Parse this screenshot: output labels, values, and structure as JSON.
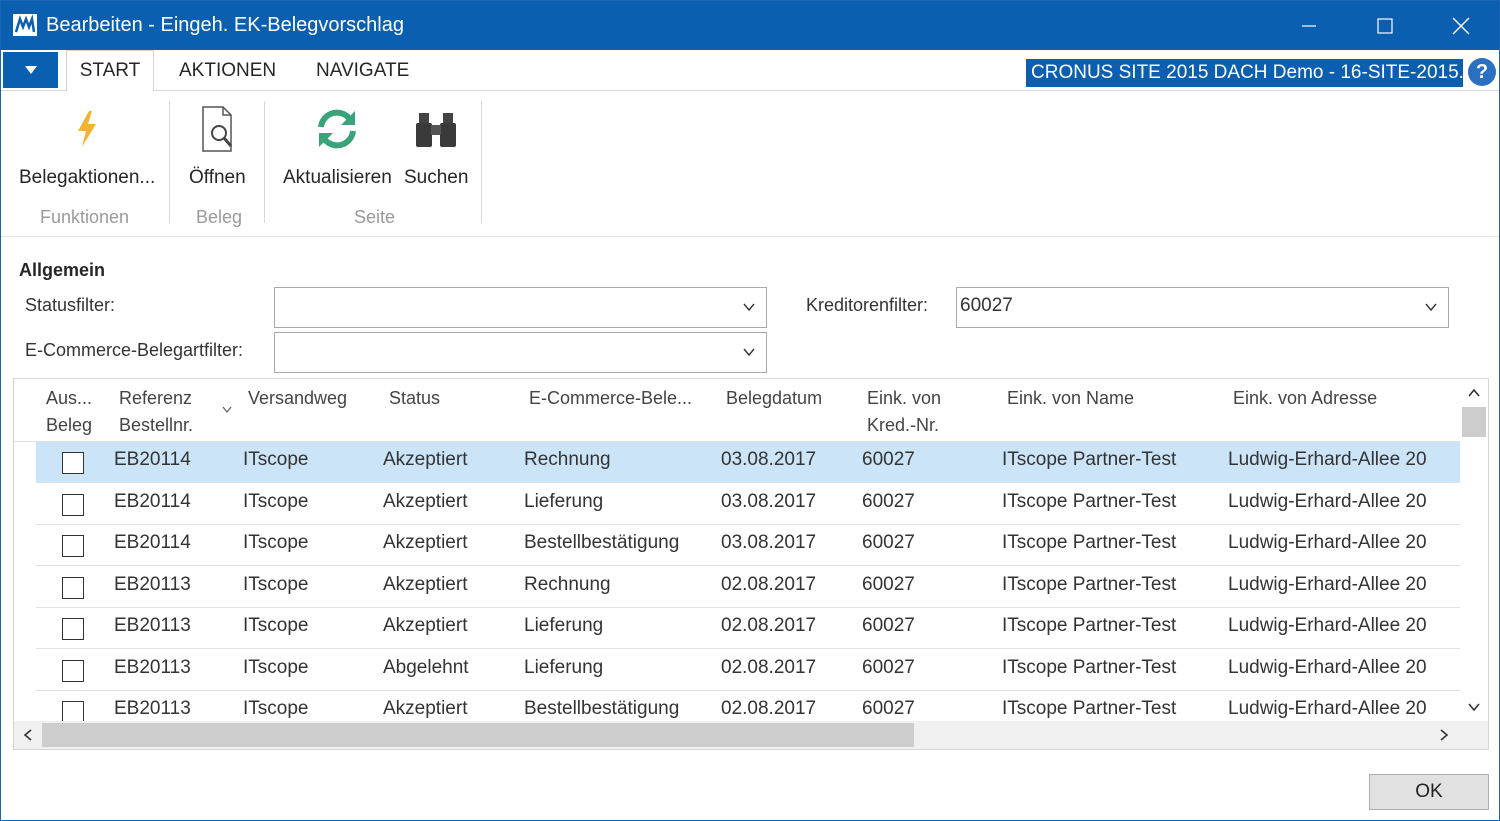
{
  "window": {
    "title": "Bearbeiten - Eingeh. EK-Belegvorschlag",
    "accent_color": "#0b5fb0"
  },
  "ribbon": {
    "tabs": [
      {
        "label": "START"
      },
      {
        "label": "AKTIONEN"
      },
      {
        "label": "NAVIGATE"
      }
    ],
    "company": "CRONUS SITE 2015 DACH Demo - 16-SITE-2015...",
    "help": "?",
    "buttons": [
      {
        "label": "Belegaktionen...",
        "icon": "lightning-icon"
      },
      {
        "label": "Öffnen",
        "icon": "open-document-icon"
      },
      {
        "label": "Aktualisieren",
        "icon": "refresh-icon"
      },
      {
        "label": "Suchen",
        "icon": "binoculars-icon"
      }
    ],
    "groups": [
      {
        "label": "Funktionen"
      },
      {
        "label": "Beleg"
      },
      {
        "label": "Seite"
      }
    ]
  },
  "general": {
    "title": "Allgemein",
    "status_filter_label": "Statusfilter:",
    "status_filter_value": "",
    "kreditor_filter_label": "Kreditorenfilter:",
    "kreditor_filter_value": "60027",
    "ecommerce_filter_label": "E-Commerce-Belegartfilter:",
    "ecommerce_filter_value": ""
  },
  "grid": {
    "headers": {
      "aus_beleg_1": "Aus...",
      "aus_beleg_2": "Beleg",
      "referenz_1": "Referenz",
      "referenz_2": "Bestellnr.",
      "versandweg": "Versandweg",
      "status": "Status",
      "ecommerce": "E-Commerce-Bele...",
      "belegdatum": "Belegdatum",
      "eink_von_1": "Eink. von",
      "eink_von_2": "Kred.-Nr.",
      "eink_name": "Eink. von Name",
      "eink_adresse": "Eink. von Adresse"
    },
    "rows": [
      {
        "ref": "EB20114",
        "versand": "ITscope",
        "status": "Akzeptiert",
        "typ": "Rechnung",
        "datum": "03.08.2017",
        "kred": "60027",
        "name": "ITscope Partner-Test",
        "adresse": "Ludwig-Erhard-Allee 20"
      },
      {
        "ref": "EB20114",
        "versand": "ITscope",
        "status": "Akzeptiert",
        "typ": "Lieferung",
        "datum": "03.08.2017",
        "kred": "60027",
        "name": "ITscope Partner-Test",
        "adresse": "Ludwig-Erhard-Allee 20"
      },
      {
        "ref": "EB20114",
        "versand": "ITscope",
        "status": "Akzeptiert",
        "typ": "Bestellbestätigung",
        "datum": "03.08.2017",
        "kred": "60027",
        "name": "ITscope Partner-Test",
        "adresse": "Ludwig-Erhard-Allee 20"
      },
      {
        "ref": "EB20113",
        "versand": "ITscope",
        "status": "Akzeptiert",
        "typ": "Rechnung",
        "datum": "02.08.2017",
        "kred": "60027",
        "name": "ITscope Partner-Test",
        "adresse": "Ludwig-Erhard-Allee 20"
      },
      {
        "ref": "EB20113",
        "versand": "ITscope",
        "status": "Akzeptiert",
        "typ": "Lieferung",
        "datum": "02.08.2017",
        "kred": "60027",
        "name": "ITscope Partner-Test",
        "adresse": "Ludwig-Erhard-Allee 20"
      },
      {
        "ref": "EB20113",
        "versand": "ITscope",
        "status": "Abgelehnt",
        "typ": "Lieferung",
        "datum": "02.08.2017",
        "kred": "60027",
        "name": "ITscope Partner-Test",
        "adresse": "Ludwig-Erhard-Allee 20"
      },
      {
        "ref": "EB20113",
        "versand": "ITscope",
        "status": "Akzeptiert",
        "typ": "Bestellbestätigung",
        "datum": "02.08.2017",
        "kred": "60027",
        "name": "ITscope Partner-Test",
        "adresse": "Ludwig-Erhard-Allee 20"
      }
    ]
  },
  "footer": {
    "ok_label": "OK"
  }
}
